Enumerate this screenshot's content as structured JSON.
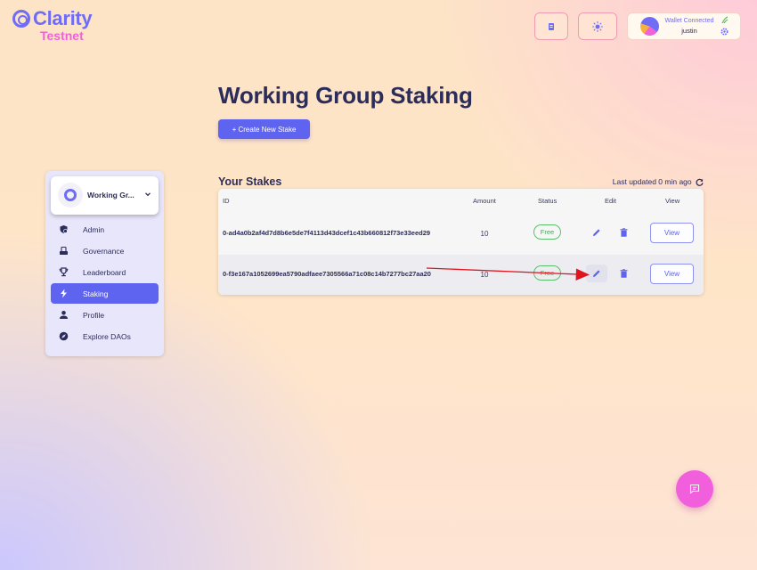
{
  "brand": {
    "name": "Clarity",
    "network": "Testnet"
  },
  "header": {
    "theme_toggle_icon": "sun-icon",
    "book_icon": "book-icon",
    "wallet": {
      "status": "Wallet Connected",
      "user": "justin"
    }
  },
  "page": {
    "title": "Working Group Staking",
    "create_button": "+ Create New Stake"
  },
  "sidebar": {
    "dao_name": "Working Gr...",
    "items": [
      {
        "label": "Admin",
        "icon": "admin-icon"
      },
      {
        "label": "Governance",
        "icon": "governance-icon"
      },
      {
        "label": "Leaderboard",
        "icon": "trophy-icon"
      },
      {
        "label": "Staking",
        "icon": "bolt-icon",
        "active": true
      },
      {
        "label": "Profile",
        "icon": "person-icon"
      },
      {
        "label": "Explore DAOs",
        "icon": "compass-icon"
      }
    ]
  },
  "stakes": {
    "title": "Your Stakes",
    "last_updated": "Last updated 0 min ago",
    "columns": [
      "ID",
      "Amount",
      "Status",
      "Edit",
      "View"
    ],
    "rows": [
      {
        "id": "0-ad4a0b2af4d7d8b6e5de7f4113d43dcef1c43b660812f73e33eed29",
        "amount": "10",
        "status": "Free",
        "view": "View"
      },
      {
        "id": "0-f3e167a1052699ea5790adfaee7305566a71c08c14b7277bc27aa20",
        "amount": "10",
        "status": "Free",
        "view": "View"
      }
    ]
  },
  "colors": {
    "accent": "#5e63f0",
    "brand_pink": "#ef62d8",
    "free_badge": "#5bbf6a",
    "annotation_arrow": "#e0141e"
  }
}
